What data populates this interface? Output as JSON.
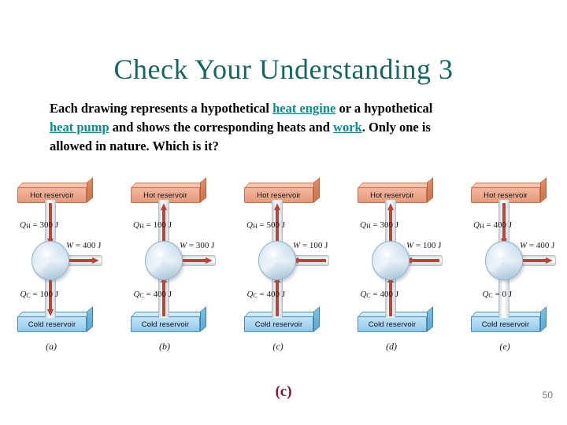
{
  "slide": {
    "title": "Check Your Understanding 3",
    "title_color": "#186660",
    "page_number": "50",
    "answer": "(c)",
    "answer_color": "#7b1238"
  },
  "question": {
    "segments": [
      {
        "text": "Each drawing represents a hypothetical ",
        "link": false
      },
      {
        "text": "heat engine",
        "link": true
      },
      {
        "text": " or a hypothetical ",
        "link": false
      },
      {
        "text": "heat pump",
        "link": true
      },
      {
        "text": " and shows the corresponding heats and ",
        "link": false
      },
      {
        "text": "work",
        "link": true
      },
      {
        "text": ". Only one is allowed in nature. Which is it?",
        "link": false
      }
    ],
    "link_color": "#0d8b8b"
  },
  "diagram": {
    "hot_reservoir_label": "Hot reservoir",
    "cold_reservoir_label": "Cold reservoir",
    "hot_color": "#eca88d",
    "cold_color": "#a9d7f2",
    "arrow_color": "#b6453c",
    "engine_color": "#cfe0ec",
    "panels": [
      {
        "caption": "(a)",
        "qh_symbol": "Q",
        "qh_sub": "H",
        "qh_text": "= 300 J",
        "qh_value": 300,
        "qh_direction": "down",
        "qc_symbol": "Q",
        "qc_sub": "C",
        "qc_text": "= 100 J",
        "qc_value": 100,
        "qc_direction": "down",
        "w_symbol": "W",
        "w_text": "= 400 J",
        "w_value": 400,
        "w_direction": "right"
      },
      {
        "caption": "(b)",
        "qh_symbol": "Q",
        "qh_sub": "H",
        "qh_text": "= 100 J",
        "qh_value": 100,
        "qh_direction": "up",
        "qc_symbol": "Q",
        "qc_sub": "C",
        "qc_text": "= 400 J",
        "qc_value": 400,
        "qc_direction": "up",
        "w_symbol": "W",
        "w_text": "= 300 J",
        "w_value": 300,
        "w_direction": "right"
      },
      {
        "caption": "(c)",
        "qh_symbol": "Q",
        "qh_sub": "H",
        "qh_text": "= 500 J",
        "qh_value": 500,
        "qh_direction": "up",
        "qc_symbol": "Q",
        "qc_sub": "C",
        "qc_text": "= 400 J",
        "qc_value": 400,
        "qc_direction": "up",
        "w_symbol": "W",
        "w_text": "= 100 J",
        "w_value": 100,
        "w_direction": "left"
      },
      {
        "caption": "(d)",
        "qh_symbol": "Q",
        "qh_sub": "H",
        "qh_text": "= 300 J",
        "qh_value": 300,
        "qh_direction": "up",
        "qc_symbol": "Q",
        "qc_sub": "C",
        "qc_text": "= 400 J",
        "qc_value": 400,
        "qc_direction": "up",
        "w_symbol": "W",
        "w_text": "= 100 J",
        "w_value": 100,
        "w_direction": "left"
      },
      {
        "caption": "(e)",
        "qh_symbol": "Q",
        "qh_sub": "H",
        "qh_text": "= 400 J",
        "qh_value": 400,
        "qh_direction": "down",
        "qc_symbol": "Q",
        "qc_sub": "C",
        "qc_text": "= 0 J",
        "qc_value": 0,
        "qc_direction": "none",
        "w_symbol": "W",
        "w_text": "= 400 J",
        "w_value": 400,
        "w_direction": "right"
      }
    ]
  }
}
